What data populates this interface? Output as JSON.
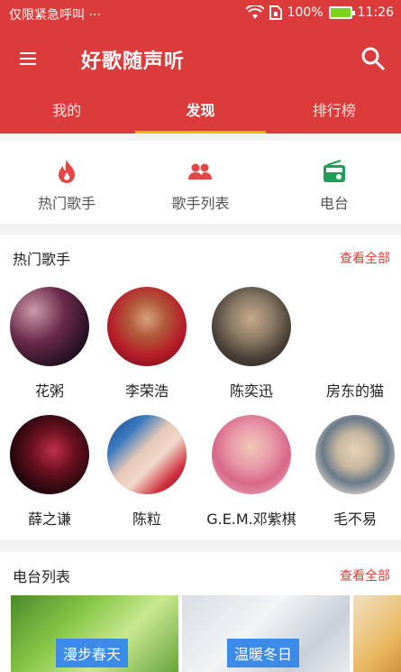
{
  "status_bar": {
    "carrier": "仅限紧急呼叫 ···",
    "battery": "100%",
    "time": "11:26"
  },
  "app": {
    "title": "好歌随声听"
  },
  "tabs": [
    {
      "label": "我的"
    },
    {
      "label": "发现"
    },
    {
      "label": "排行榜"
    }
  ],
  "quick_links": [
    {
      "label": "热门歌手",
      "icon": "flame-icon"
    },
    {
      "label": "歌手列表",
      "icon": "people-icon"
    },
    {
      "label": "电台",
      "icon": "radio-icon"
    }
  ],
  "hot_singers": {
    "title": "热门歌手",
    "more": "查看全部",
    "singers": [
      {
        "name": "花粥"
      },
      {
        "name": "李荣浩"
      },
      {
        "name": "陈奕迅"
      },
      {
        "name": "房东的猫"
      },
      {
        "name": "薛之谦"
      },
      {
        "name": "陈粒"
      },
      {
        "name": "G.E.M.邓紫棋"
      },
      {
        "name": "毛不易"
      }
    ]
  },
  "radio_list": {
    "title": "电台列表",
    "more": "查看全部",
    "stations": [
      {
        "name": "漫步春天"
      },
      {
        "name": "温暖冬日"
      }
    ]
  },
  "colors": {
    "primary": "#dc3b3b",
    "tab_indicator": "#f7b500",
    "tag": "#3d8be8"
  }
}
